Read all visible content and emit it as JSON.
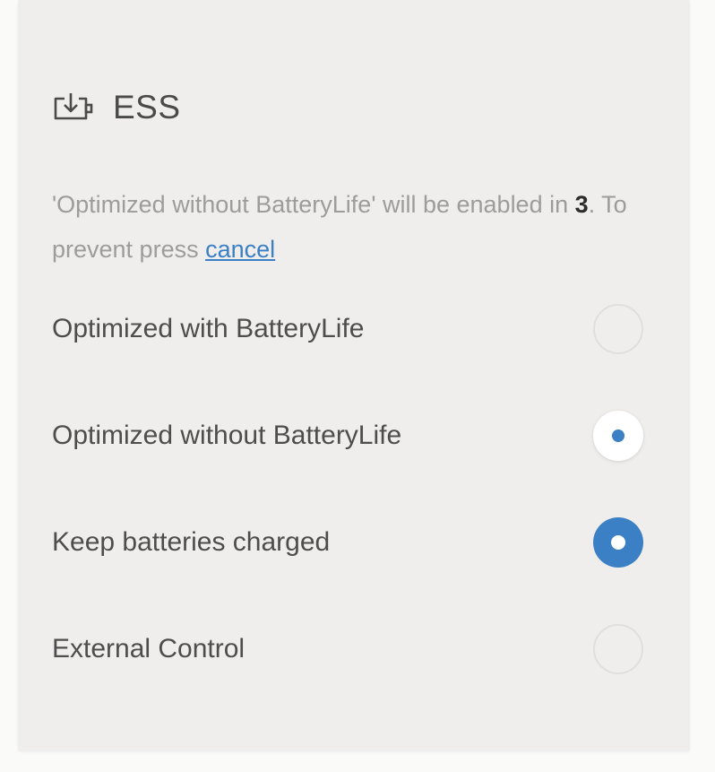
{
  "section": {
    "title": "ESS",
    "icon": "battery-download-icon"
  },
  "notice": {
    "prefix": "'Optimized without BatteryLife' will be enabled in ",
    "countdown": "3",
    "middle": ". To prevent press ",
    "cancel_label": "cancel"
  },
  "options": [
    {
      "label": "Optimized with BatteryLife",
      "state": "unselected"
    },
    {
      "label": "Optimized without BatteryLife",
      "state": "pending"
    },
    {
      "label": "Keep batteries charged",
      "state": "selected"
    },
    {
      "label": "External Control",
      "state": "unselected"
    }
  ],
  "colors": {
    "accent": "#3b7fc4",
    "panel_background": "#efeeec",
    "notice_text": "#9c9c9c",
    "label_text": "#4d4d4d"
  }
}
